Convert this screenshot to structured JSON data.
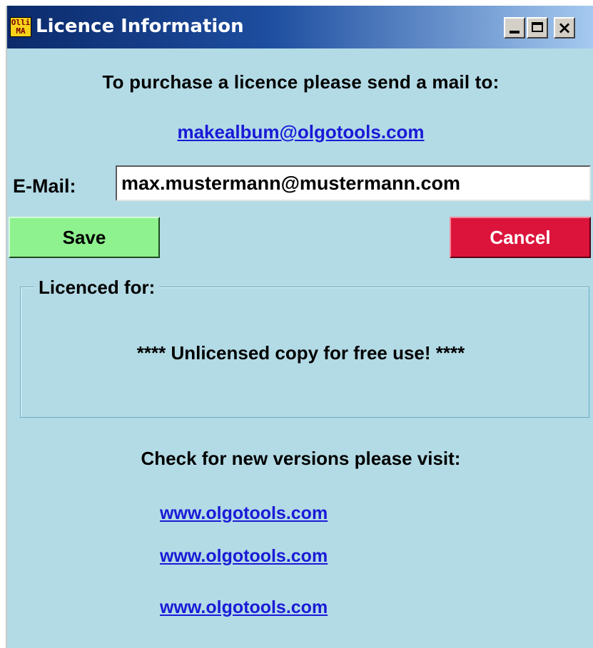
{
  "window": {
    "title": "Licence Information",
    "icon_text": [
      "Olli",
      "MA"
    ],
    "close_glyph": "×"
  },
  "instructions": {
    "purchase_text": "To purchase a licence please send a mail to:",
    "purchase_email": "makealbum@olgotools.com"
  },
  "email_field": {
    "label": "E-Mail:",
    "value": "max.mustermann@mustermann.com"
  },
  "buttons": {
    "save_label": "Save",
    "cancel_label": "Cancel"
  },
  "licence_group": {
    "legend": "Licenced for:",
    "status": "**** Unlicensed copy for free use! ****"
  },
  "updates": {
    "check_text": "Check for new versions please visit:",
    "links": [
      "www.olgotools.com",
      "www.olgotools.com",
      "www.olgotools.com"
    ]
  },
  "colors": {
    "client_background": "#b3dbe6",
    "save_button": "#8ef28e",
    "cancel_button": "#dc143c",
    "link": "#1a1ad6"
  }
}
